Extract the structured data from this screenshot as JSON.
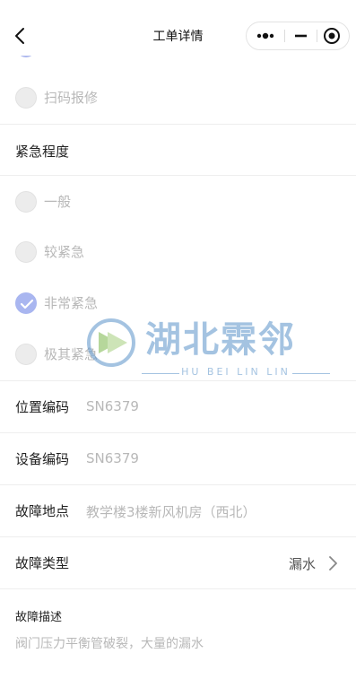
{
  "nav": {
    "title": "工单详情"
  },
  "source": {
    "options": [
      {
        "label": "扫码报修",
        "checked": false
      }
    ]
  },
  "urgency": {
    "title": "紧急程度",
    "options": [
      {
        "label": "一般",
        "checked": false
      },
      {
        "label": "较紧急",
        "checked": false
      },
      {
        "label": "非常紧急",
        "checked": true
      },
      {
        "label": "极其紧急",
        "checked": false
      }
    ]
  },
  "fields": {
    "location_code": {
      "label": "位置编码",
      "value": "SN6379"
    },
    "device_code": {
      "label": "设备编码",
      "value": "SN6379"
    },
    "fault_place": {
      "label": "故障地点",
      "value": "教学楼3楼新风机房（西北）"
    },
    "fault_type": {
      "label": "故障类型",
      "value": "漏水"
    }
  },
  "description": {
    "label": "故障描述",
    "value": "阀门压力平衡管破裂，大量的漏水"
  },
  "watermark": {
    "title": "湖北霖邻",
    "subtitle": "HU BEI LIN LIN"
  },
  "colors": {
    "accent": "#a9b6f0",
    "muted_text": "#b8b8b8",
    "divider": "#eeeeee"
  }
}
